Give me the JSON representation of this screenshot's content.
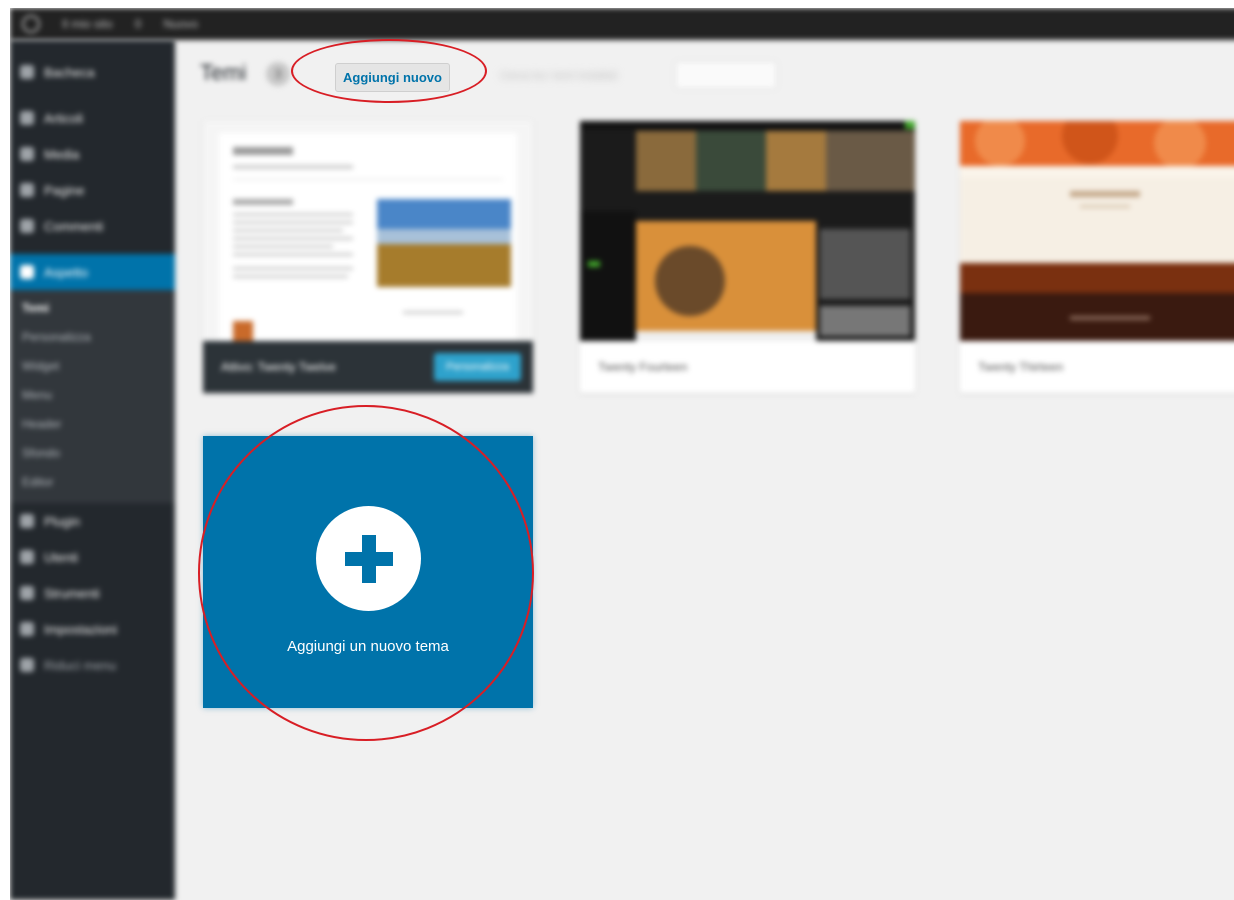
{
  "adminbar": {
    "items": [
      "Il mio sito",
      "0",
      "Nuovo"
    ]
  },
  "sidebar": {
    "items_top": [
      "Bacheca",
      "Articoli",
      "Media",
      "Pagine",
      "Commenti"
    ],
    "active": "Aspetto",
    "submenu": [
      "Temi",
      "Personalizza",
      "Widget",
      "Menu",
      "Header",
      "Sfondo",
      "Editor"
    ],
    "items_bottom": [
      "Plugin",
      "Utenti",
      "Strumenti",
      "Impostazioni",
      "Riduci menu"
    ]
  },
  "header": {
    "title": "Temi",
    "count": "3",
    "add_new": "Aggiungi nuovo",
    "search_hint": "Cerca tra i temi installati"
  },
  "themes": [
    {
      "name": "Attivo: Twenty Twelve",
      "customize": "Personalizza"
    },
    {
      "name": "Twenty Fourteen"
    },
    {
      "name": "Twenty Thirteen"
    }
  ],
  "add_theme": {
    "label": "Aggiungi un nuovo tema"
  },
  "colors": {
    "accent": "#0073aa",
    "annotation": "#d81e25",
    "sidebar": "#23282d"
  }
}
